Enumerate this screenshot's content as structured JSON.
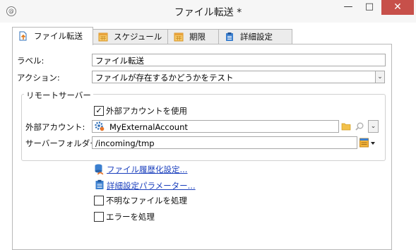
{
  "window": {
    "title": "ファイル転送 *"
  },
  "tabs": [
    {
      "label": "ファイル転送",
      "icon": "file-transfer-icon",
      "active": true
    },
    {
      "label": "スケジュール",
      "icon": "calendar-icon",
      "active": false
    },
    {
      "label": "期限",
      "icon": "calendar-icon",
      "active": false
    },
    {
      "label": "詳細設定",
      "icon": "clipboard-icon",
      "active": false
    }
  ],
  "form": {
    "label_caption": "ラベル:",
    "label_value": "ファイル転送",
    "action_caption": "アクション:",
    "action_value": "ファイルが存在するかどうかをテスト"
  },
  "remote_server": {
    "legend": "リモートサーバー",
    "use_external_account": {
      "label": "外部アカウントを使用",
      "checked": true
    },
    "external_account_caption": "外部アカウント:",
    "external_account_value": "MyExternalAccount",
    "server_folder_caption": "サーバーフォルダー:",
    "server_folder_value": "/incoming/tmp"
  },
  "links": {
    "file_history": "ファイル履歴化設定...",
    "advanced_params": "詳細設定パラメーター..."
  },
  "options": {
    "process_unknown_files": {
      "label": "不明なファイルを処理",
      "checked": false
    },
    "process_errors": {
      "label": "エラーを処理",
      "checked": false
    }
  },
  "colors": {
    "link": "#1a3fbd",
    "close_button": "#c7504a",
    "accent_blue": "#2f7ed8",
    "calendar_orange": "#e8a23a"
  }
}
